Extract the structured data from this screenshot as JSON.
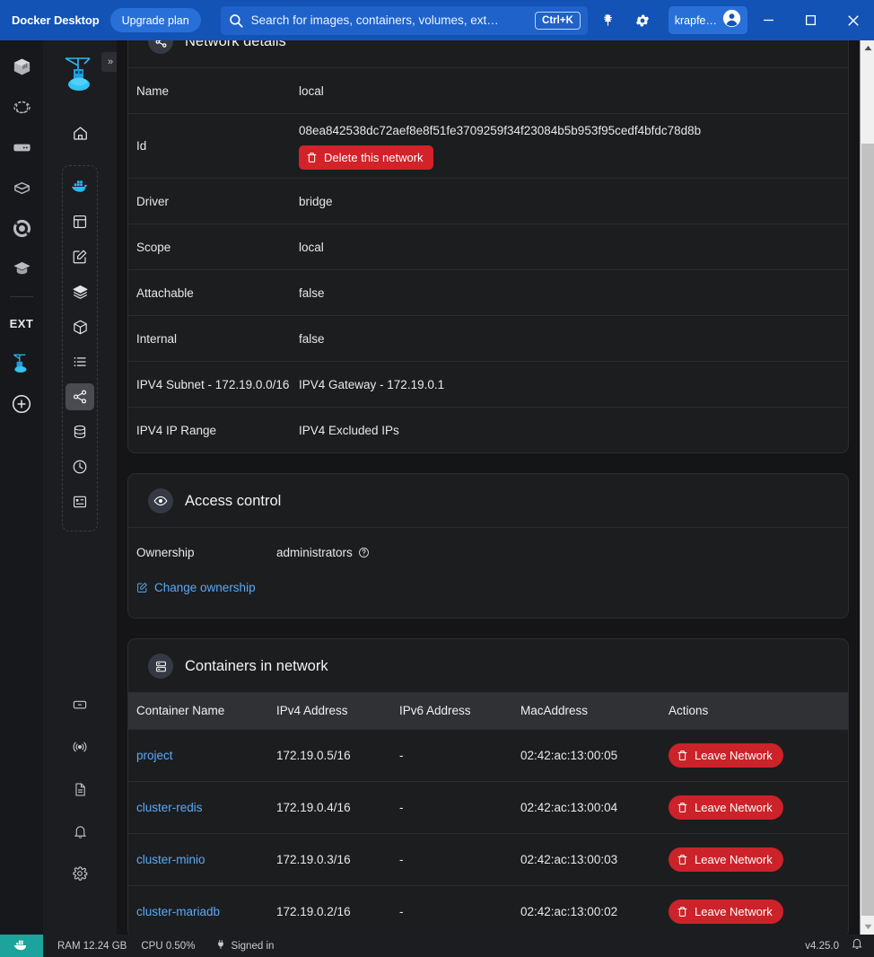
{
  "titlebar": {
    "brand": "Docker Desktop",
    "upgrade_label": "Upgrade plan",
    "search_placeholder": "Search for images, containers, volumes, ext…",
    "search_shortcut": "Ctrl+K",
    "bug_icon": "bug-icon",
    "settings_icon": "gear-icon",
    "user_name": "krapfe…",
    "minimize": "minimize-icon",
    "maximize": "maximize-icon",
    "close": "close-icon",
    "bg_color": "#1353b5"
  },
  "rail": {
    "items": [
      {
        "name": "container-icon"
      },
      {
        "name": "dev-environments-icon"
      },
      {
        "name": "server-icon"
      },
      {
        "name": "volumes-icon"
      },
      {
        "name": "kubernetes-icon"
      },
      {
        "name": "learning-center-icon"
      }
    ],
    "ext_label": "EXT",
    "docker_extension_icon": "docker-crane-icon",
    "add_extension_icon": "plus-circle-icon"
  },
  "sidebar": {
    "logo": "docker-crane-logo",
    "collapse_label": "»",
    "home": {
      "label": "Home",
      "icon": "home-icon"
    },
    "items": [
      {
        "label": "Containers",
        "icon": "whale-icon",
        "active": false
      },
      {
        "label": "Dashboard",
        "icon": "dashboard-icon",
        "active": false
      },
      {
        "label": "Compose",
        "icon": "edit-square-icon",
        "active": false
      },
      {
        "label": "Images",
        "icon": "layers-icon",
        "active": false
      },
      {
        "label": "Volumes",
        "icon": "cube-icon",
        "active": false
      },
      {
        "label": "Logs",
        "icon": "list-icon",
        "active": false
      },
      {
        "label": "Networks",
        "icon": "network-share-icon",
        "active": true
      },
      {
        "label": "Databases",
        "icon": "database-icon",
        "active": false
      },
      {
        "label": "History",
        "icon": "clock-icon",
        "active": false
      },
      {
        "label": "Builds",
        "icon": "builds-icon",
        "active": false
      }
    ],
    "bottom_items": [
      {
        "label": "Archive",
        "icon": "archive-icon"
      },
      {
        "label": "Broadcast",
        "icon": "broadcast-icon"
      },
      {
        "label": "Docs",
        "icon": "document-icon"
      },
      {
        "label": "Notifications",
        "icon": "bell-icon"
      },
      {
        "label": "Settings",
        "icon": "gear-icon"
      }
    ]
  },
  "network_details": {
    "title": "Network details",
    "icon": "network-share-icon",
    "loading": true,
    "rows": [
      {
        "key": "Name",
        "value": "local"
      },
      {
        "key": "Id",
        "value": "08ea842538dc72aef8e8f51fe3709259f34f23084b5b953f95cedf4bfdc78d8b"
      },
      {
        "key": "Driver",
        "value": "bridge"
      },
      {
        "key": "Scope",
        "value": "local"
      },
      {
        "key": "Attachable",
        "value": "false"
      },
      {
        "key": "Internal",
        "value": "false"
      },
      {
        "key": "IPV4 Subnet - 172.19.0.0/16",
        "value": "IPV4 Gateway - 172.19.0.1"
      },
      {
        "key": "IPV4 IP Range",
        "value": "IPV4 Excluded IPs"
      }
    ],
    "delete_label": "Delete this network",
    "delete_color": "#d32229"
  },
  "access_control": {
    "title": "Access control",
    "icon": "eye-icon",
    "ownership_key": "Ownership",
    "ownership_value": "administrators",
    "help_icon": "question-circle-icon",
    "change_label": "Change ownership",
    "change_icon": "edit-icon",
    "link_color": "#5aa9f8"
  },
  "containers": {
    "title": "Containers in network",
    "icon": "containers-icon",
    "columns": [
      "Container Name",
      "IPv4 Address",
      "IPv6 Address",
      "MacAddress",
      "Actions"
    ],
    "action_label": "Leave Network",
    "action_color": "#cc2229",
    "rows": [
      {
        "name": "project",
        "ipv4": "172.19.0.5/16",
        "ipv6": "-",
        "mac": "02:42:ac:13:00:05"
      },
      {
        "name": "cluster-redis",
        "ipv4": "172.19.0.4/16",
        "ipv6": "-",
        "mac": "02:42:ac:13:00:04"
      },
      {
        "name": "cluster-minio",
        "ipv4": "172.19.0.3/16",
        "ipv6": "-",
        "mac": "02:42:ac:13:00:03"
      },
      {
        "name": "cluster-mariadb",
        "ipv4": "172.19.0.2/16",
        "ipv6": "-",
        "mac": "02:42:ac:13:00:02"
      }
    ]
  },
  "status_bar": {
    "whale_icon": "whale-icon",
    "ram": "RAM 12.24 GB",
    "cpu": "CPU 0.50%",
    "signed_in": "Signed in",
    "signed_icon": "plug-icon",
    "version": "v4.25.0",
    "bell_icon": "bell-icon",
    "accent_color": "#1ba39c"
  }
}
